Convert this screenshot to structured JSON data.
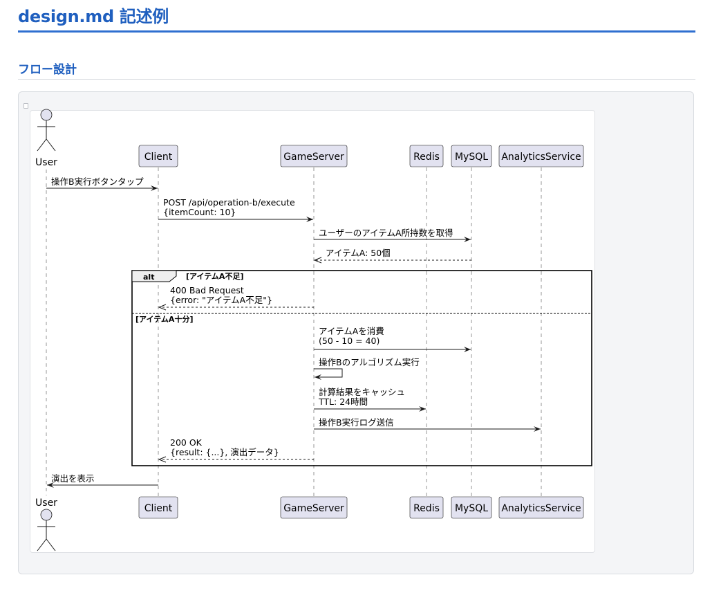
{
  "page": {
    "title": "design.md 記述例",
    "section_title": "フロー設計"
  },
  "diagram": {
    "participants": [
      {
        "id": "user",
        "label": "User",
        "kind": "actor"
      },
      {
        "id": "client",
        "label": "Client",
        "kind": "participant"
      },
      {
        "id": "gameserver",
        "label": "GameServer",
        "kind": "participant"
      },
      {
        "id": "redis",
        "label": "Redis",
        "kind": "participant"
      },
      {
        "id": "mysql",
        "label": "MySQL",
        "kind": "participant"
      },
      {
        "id": "analytics",
        "label": "AnalyticsService",
        "kind": "participant"
      }
    ],
    "messages": [
      {
        "id": "m1",
        "from": "user",
        "to": "client",
        "style": "solid",
        "lines": [
          "操作B実行ボタンタップ"
        ]
      },
      {
        "id": "m2",
        "from": "client",
        "to": "gameserver",
        "style": "solid",
        "lines": [
          "POST /api/operation-b/execute",
          "{itemCount: 10}"
        ]
      },
      {
        "id": "m3",
        "from": "gameserver",
        "to": "mysql",
        "style": "solid",
        "lines": [
          "ユーザーのアイテムA所持数を取得"
        ]
      },
      {
        "id": "m4",
        "from": "mysql",
        "to": "gameserver",
        "style": "dashed",
        "lines": [
          "アイテムA: 50個"
        ]
      },
      {
        "id": "m5",
        "from": "gameserver",
        "to": "client",
        "style": "dashed",
        "lines": [
          "400 Bad Request",
          "{error: \"アイテムA不足\"}"
        ]
      },
      {
        "id": "m6",
        "from": "gameserver",
        "to": "mysql",
        "style": "solid",
        "lines": [
          "アイテムAを消費",
          "(50 - 10 = 40)"
        ]
      },
      {
        "id": "m7",
        "from": "gameserver",
        "to": "gameserver",
        "style": "self",
        "lines": [
          "操作Bのアルゴリズム実行"
        ]
      },
      {
        "id": "m8",
        "from": "gameserver",
        "to": "redis",
        "style": "solid",
        "lines": [
          "計算結果をキャッシュ",
          "TTL: 24時間"
        ]
      },
      {
        "id": "m9",
        "from": "gameserver",
        "to": "analytics",
        "style": "solid",
        "lines": [
          "操作B実行ログ送信"
        ]
      },
      {
        "id": "m10",
        "from": "gameserver",
        "to": "client",
        "style": "dashed",
        "lines": [
          "200 OK",
          "{result: {...}, 演出データ}"
        ]
      },
      {
        "id": "m11",
        "from": "client",
        "to": "user",
        "style": "solid",
        "lines": [
          "演出を表示"
        ]
      }
    ],
    "alt_group": {
      "keyword": "alt",
      "condition_1": "[アイテムA不足]",
      "condition_2": "[アイテムA十分]"
    }
  }
}
